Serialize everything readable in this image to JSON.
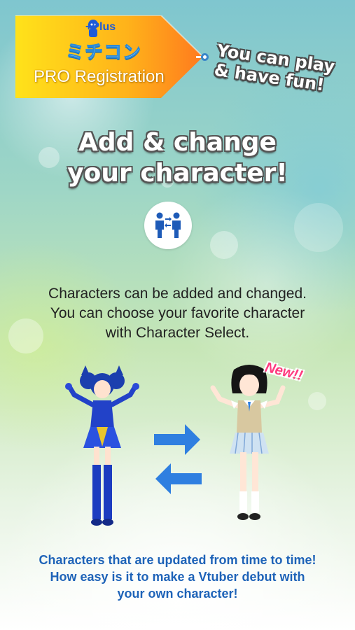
{
  "banner": {
    "logo_plus": "+Plus",
    "logo_main": "ミチコン",
    "title": "PRO Registration"
  },
  "tagline": {
    "line1": "You can play",
    "line2": "& have fun!"
  },
  "heading": {
    "line1": "Add & change",
    "line2": "your character!"
  },
  "feature_icon": "swap-people-icon",
  "description": {
    "line1": "Characters can be added and changed.",
    "line2": "You can choose your favorite character",
    "line3": "with Character Select."
  },
  "new_badge": "New!!",
  "footer": {
    "line1": "Characters that are updated from time to time!",
    "line2": "How easy is it to make a Vtuber debut with",
    "line3": "your own character!"
  },
  "colors": {
    "accent_blue": "#1e63b8",
    "arrow_blue": "#2f7fe0",
    "banner_yellow": "#ffd21a",
    "banner_orange": "#ff8a1e",
    "new_pink": "#ff3b7f"
  }
}
